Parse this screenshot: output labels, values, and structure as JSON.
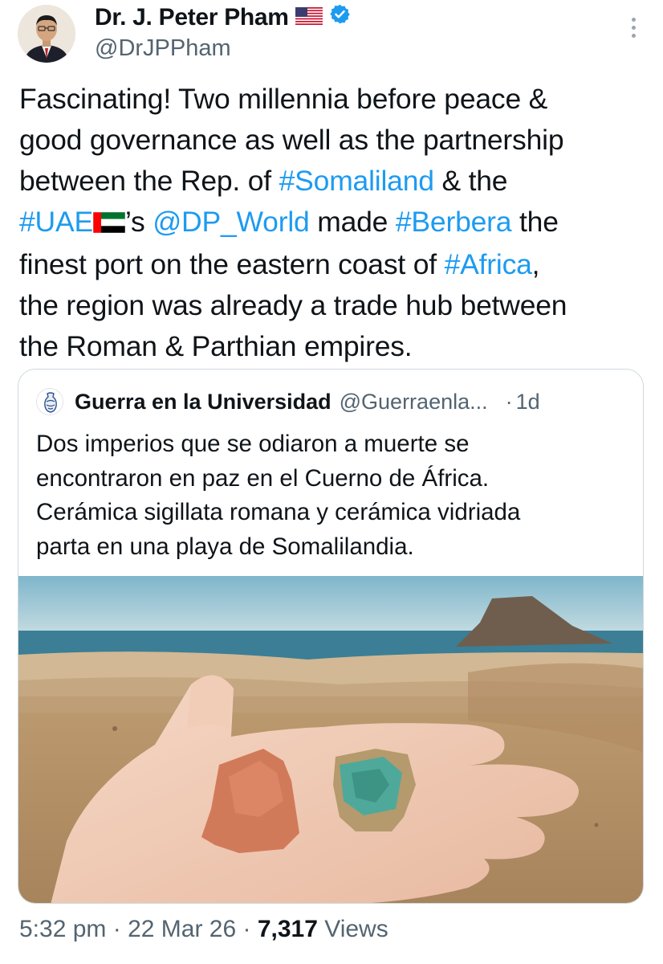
{
  "author": {
    "name": "Dr. J. Peter Pham",
    "flag_emoji": "🇺🇸",
    "handle": "@DrJPPham",
    "verified_color": "#1d9bf0"
  },
  "tweet": {
    "lines": [
      [
        {
          "t": "Fascinating! Two millennia before peace &"
        }
      ],
      [
        {
          "t": "good governance as well as the partnership"
        }
      ],
      [
        {
          "t": "between the Rep. of "
        },
        {
          "t": "#Somaliland",
          "link": true
        },
        {
          "t": " & the"
        }
      ],
      [
        {
          "t": "#UAE",
          "link": true
        },
        {
          "flag": "uae"
        },
        {
          "t": "’s "
        },
        {
          "t": "@DP_World",
          "link": true
        },
        {
          "t": " made "
        },
        {
          "t": "#Berbera",
          "link": true
        },
        {
          "t": " the"
        }
      ],
      [
        {
          "t": "finest port on the eastern coast of "
        },
        {
          "t": "#Africa",
          "link": true
        },
        {
          "t": ","
        }
      ],
      [
        {
          "t": "the region was already a trade hub between"
        }
      ],
      [
        {
          "t": "the Roman & Parthian empires."
        }
      ]
    ]
  },
  "quote": {
    "name": "Guerra en la Universidad",
    "handle": "@Guerraenla...",
    "dot": "·",
    "time": "1d",
    "lines": [
      "Dos imperios que se odiaron a muerte se",
      "encontraron en paz en el Cuerno de África.",
      "Cerámica sigillata romana y cerámica vidriada",
      "parta en una playa de Somalilandia."
    ]
  },
  "footer": {
    "time": "5:32 pm",
    "sep1": " · ",
    "date": "22 Mar 26",
    "sep2": " · ",
    "views_count": "7,317",
    "views_label": " Views"
  },
  "colors": {
    "link": "#1d9bf0",
    "secondary_text": "#536471",
    "border": "#cfd9de"
  }
}
